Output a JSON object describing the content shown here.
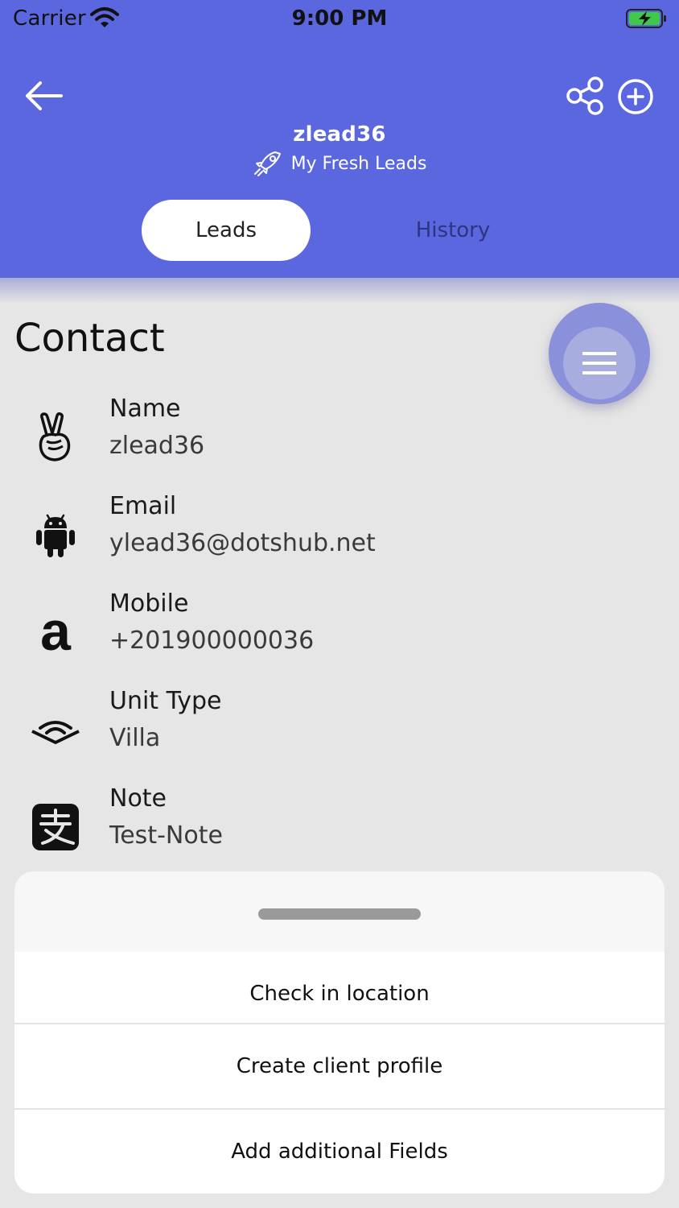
{
  "status_bar": {
    "carrier": "Carrier",
    "time": "9:00 PM"
  },
  "header": {
    "title": "zlead36",
    "subtitle": "My Fresh Leads",
    "accent_color": "#5b67de"
  },
  "tabs": [
    {
      "label": "Leads",
      "active": true
    },
    {
      "label": "History",
      "active": false
    }
  ],
  "contact": {
    "section_title": "Contact",
    "fields": [
      {
        "label": "Name",
        "value": "zlead36",
        "icon": "peace-hand-icon"
      },
      {
        "label": "Email",
        "value": "ylead36@dotshub.net",
        "icon": "android-icon"
      },
      {
        "label": "Mobile",
        "value": "+201900000036",
        "icon": "amazon-icon"
      },
      {
        "label": "Unit Type",
        "value": "Villa",
        "icon": "audible-icon"
      },
      {
        "label": "Note",
        "value": "Test-Note",
        "icon": "alipay-icon"
      }
    ]
  },
  "sheet": {
    "items": [
      {
        "label": "Check in location"
      },
      {
        "label": "Create client profile"
      },
      {
        "label": "Add additional Fields"
      }
    ]
  }
}
